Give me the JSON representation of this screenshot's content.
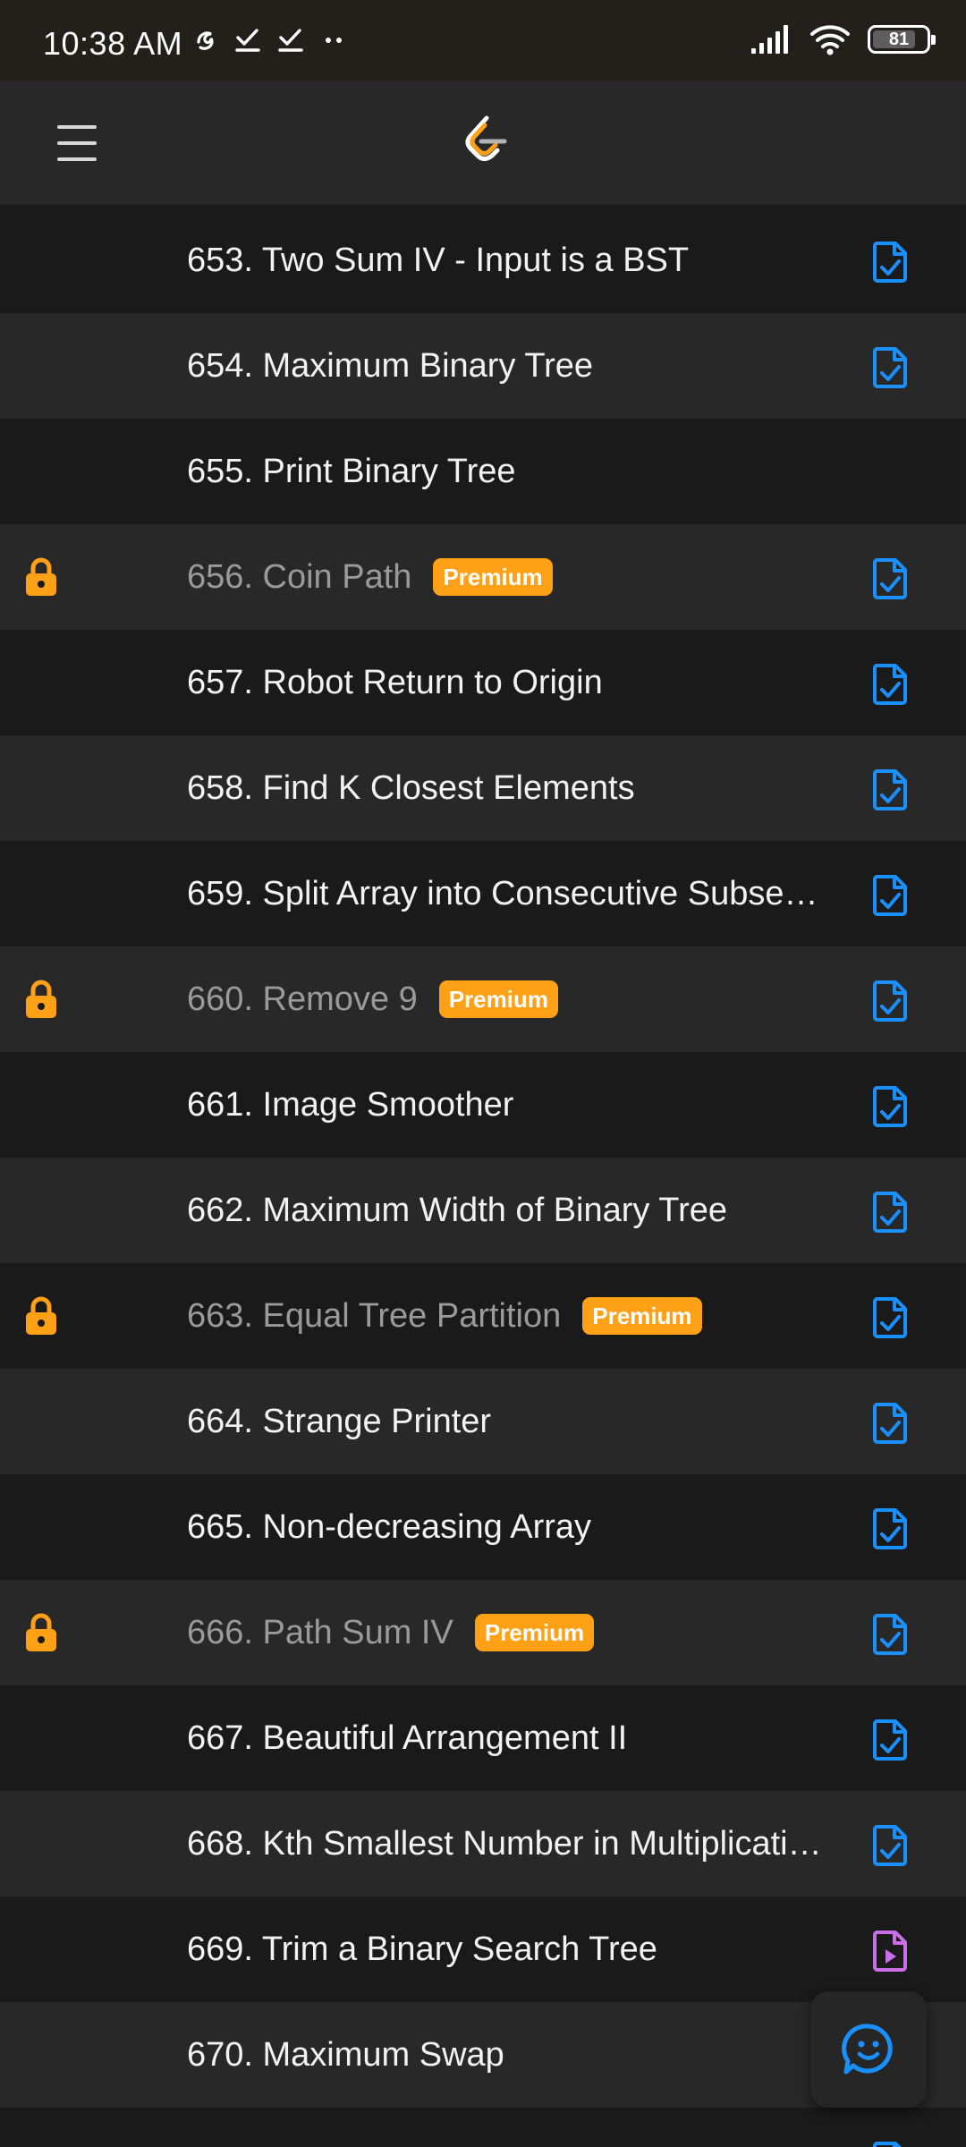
{
  "status_bar": {
    "time": "10:38 AM",
    "battery": "81",
    "battery_level": 0.81,
    "icons": [
      "notification-icon",
      "check-icon",
      "check-icon",
      "more-dots-icon",
      "signal-icon",
      "wifi-icon",
      "battery-icon"
    ]
  },
  "header": {
    "menu_icon": "hamburger-menu-icon",
    "logo": "leetcode-logo"
  },
  "colors": {
    "premium": "#ffa116",
    "lock": "#ffa116",
    "doc_solution": "#1a90ff",
    "doc_video": "#c86ee6"
  },
  "problems": [
    {
      "title": "653. Two Sum IV - Input is a BST",
      "locked": false,
      "premium_label": "",
      "doc_icon": "solution-doc-icon"
    },
    {
      "title": "654. Maximum Binary Tree",
      "locked": false,
      "premium_label": "",
      "doc_icon": "solution-doc-icon"
    },
    {
      "title": "655. Print Binary Tree",
      "locked": false,
      "premium_label": "",
      "doc_icon": ""
    },
    {
      "title": "656. Coin Path",
      "locked": true,
      "premium_label": "Premium",
      "doc_icon": "solution-doc-icon"
    },
    {
      "title": "657. Robot Return to Origin",
      "locked": false,
      "premium_label": "",
      "doc_icon": "solution-doc-icon"
    },
    {
      "title": "658. Find K Closest Elements",
      "locked": false,
      "premium_label": "",
      "doc_icon": "solution-doc-icon"
    },
    {
      "title": "659. Split Array into Consecutive Subse…",
      "locked": false,
      "premium_label": "",
      "doc_icon": "solution-doc-icon"
    },
    {
      "title": "660. Remove 9",
      "locked": true,
      "premium_label": "Premium",
      "doc_icon": "solution-doc-icon"
    },
    {
      "title": "661. Image Smoother",
      "locked": false,
      "premium_label": "",
      "doc_icon": "solution-doc-icon"
    },
    {
      "title": "662. Maximum Width of Binary Tree",
      "locked": false,
      "premium_label": "",
      "doc_icon": "solution-doc-icon"
    },
    {
      "title": "663. Equal Tree Partition",
      "locked": true,
      "premium_label": "Premium",
      "doc_icon": "solution-doc-icon"
    },
    {
      "title": "664. Strange Printer",
      "locked": false,
      "premium_label": "",
      "doc_icon": "solution-doc-icon"
    },
    {
      "title": "665. Non-decreasing Array",
      "locked": false,
      "premium_label": "",
      "doc_icon": "solution-doc-icon"
    },
    {
      "title": "666. Path Sum IV",
      "locked": true,
      "premium_label": "Premium",
      "doc_icon": "solution-doc-icon"
    },
    {
      "title": "667. Beautiful Arrangement II",
      "locked": false,
      "premium_label": "",
      "doc_icon": "solution-doc-icon"
    },
    {
      "title": "668. Kth Smallest Number in Multiplicati…",
      "locked": false,
      "premium_label": "",
      "doc_icon": "solution-doc-icon"
    },
    {
      "title": "669. Trim a Binary Search Tree",
      "locked": false,
      "premium_label": "",
      "doc_icon": "video-doc-icon"
    },
    {
      "title": "670. Maximum Swap",
      "locked": false,
      "premium_label": "",
      "doc_icon": ""
    },
    {
      "title": "",
      "locked": false,
      "premium_label": "",
      "doc_icon": "solution-doc-icon"
    }
  ],
  "fab": {
    "icon": "chat-smiley-icon"
  }
}
